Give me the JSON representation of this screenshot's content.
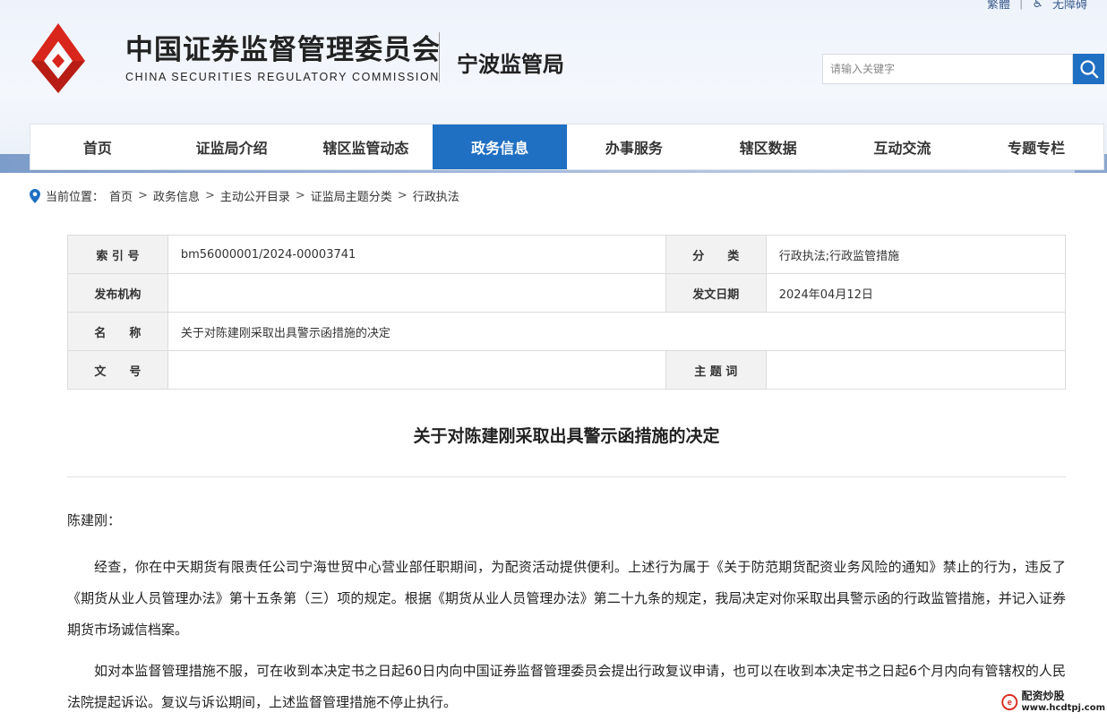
{
  "header": {
    "top_links": [
      "繁體",
      "无障碍"
    ],
    "org_name_cn": "中国证券监督管理委员会",
    "org_name_en": "CHINA SECURITIES REGULATORY COMMISSION",
    "bureau": "宁波监管局",
    "search_placeholder": "请输入关键字"
  },
  "nav": {
    "items": [
      "首页",
      "证监局介绍",
      "辖区监管动态",
      "政务信息",
      "办事服务",
      "辖区数据",
      "互动交流",
      "专题专栏"
    ],
    "active": "政务信息"
  },
  "breadcrumb": {
    "label": "当前位置：",
    "items": [
      "首页",
      "政务信息",
      "主动公开目录",
      "证监局主题分类",
      "行政执法"
    ]
  },
  "meta": {
    "index_label": "索 引 号",
    "index_value": "bm56000001/2024-00003741",
    "category_label": "分　　类",
    "category_value": "行政执法;行政监管措施",
    "publisher_label": "发布机构",
    "publisher_value": "",
    "date_label": "发文日期",
    "date_value": "2024年04月12日",
    "name_label": "名　　称",
    "name_value": "关于对陈建刚采取出具警示函措施的决定",
    "docno_label": "文　　号",
    "docno_value": "",
    "subject_label": "主 题 词",
    "subject_value": ""
  },
  "document": {
    "title": "关于对陈建刚采取出具警示函措施的决定",
    "salutation": "陈建刚：",
    "paragraphs": [
      "经查，你在中天期货有限责任公司宁海世贸中心营业部任职期间，为配资活动提供便利。上述行为属于《关于防范期货配资业务风险的通知》禁止的行为，违反了《期货从业人员管理办法》第十五条第（三）项的规定。根据《期货从业人员管理办法》第二十九条的规定，我局决定对你采取出具警示函的行政监管措施，并记入证券期货市场诚信档案。",
      "如对本监督管理措施不服，可在收到本决定书之日起60日内向中国证券监督管理委员会提出行政复议申请，也可以在收到本决定书之日起6个月内向有管辖权的人民法院提起诉讼。复议与诉讼期间，上述监督管理措施不停止执行。"
    ]
  },
  "watermark": {
    "name": "配资炒股",
    "url": "www.hcdtpj.com"
  },
  "colors": {
    "primary": "#1f6fc2",
    "logo_red": "#d9261c"
  }
}
